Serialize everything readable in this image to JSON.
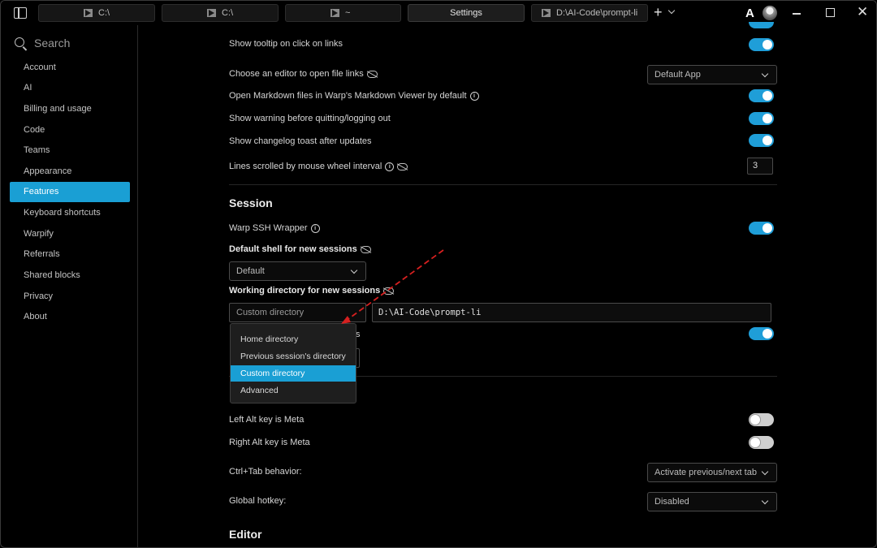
{
  "titlebar": {
    "tabs": [
      {
        "label": "C:\\",
        "active": false
      },
      {
        "label": "C:\\",
        "active": false
      },
      {
        "label": "~",
        "active": false
      },
      {
        "label": "Settings",
        "active": true
      },
      {
        "label": "D:\\AI-Code\\prompt-li",
        "active": false
      }
    ],
    "new_tab_label": "+",
    "logo_glyph": "A",
    "close_glyph": "✕"
  },
  "sidebar": {
    "search_placeholder": "Search",
    "items": [
      {
        "label": "Account"
      },
      {
        "label": "AI"
      },
      {
        "label": "Billing and usage"
      },
      {
        "label": "Code"
      },
      {
        "label": "Teams"
      },
      {
        "label": "Appearance"
      },
      {
        "label": "Features",
        "active": true
      },
      {
        "label": "Keyboard shortcuts"
      },
      {
        "label": "Warpify"
      },
      {
        "label": "Referrals"
      },
      {
        "label": "Shared blocks"
      },
      {
        "label": "Privacy"
      },
      {
        "label": "About"
      }
    ]
  },
  "settings": {
    "general": {
      "tooltip_label": "Show tooltip on click on links",
      "editor_label": "Choose an editor to open file links",
      "editor_value": "Default App",
      "markdown_label": "Open Markdown files in Warp's Markdown Viewer by default",
      "quit_warning_label": "Show warning before quitting/logging out",
      "changelog_label": "Show changelog toast after updates",
      "scroll_label": "Lines scrolled by mouse wheel interval",
      "scroll_value": "3"
    },
    "session": {
      "title": "Session",
      "ssh_label": "Warp SSH Wrapper",
      "shell_label": "Default shell for new sessions",
      "shell_value": "Default",
      "workdir_label": "Working directory for new sessions",
      "workdir_value": "Custom directory",
      "workdir_path": "D:\\AI-Code\\prompt-li",
      "peek_text": "s",
      "workdir_options": [
        "Home directory",
        "Previous session's directory",
        "Custom directory",
        "Advanced"
      ],
      "workdir_selected": "Custom directory"
    },
    "keys": {
      "left_alt_label": "Left Alt key is Meta",
      "right_alt_label": "Right Alt key is Meta",
      "ctrl_tab_label": "Ctrl+Tab behavior:",
      "ctrl_tab_value": "Activate previous/next tab",
      "hotkey_label": "Global hotkey:",
      "hotkey_value": "Disabled"
    },
    "editor": {
      "title": "Editor"
    }
  },
  "colors": {
    "accent": "#1a9fd4",
    "annotation_arrow": "#d62020"
  }
}
